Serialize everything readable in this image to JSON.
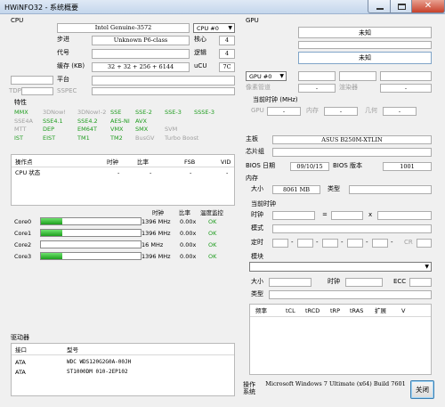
{
  "window": {
    "title": "HWiNFO32 - 系统概要"
  },
  "cpu": {
    "section": "CPU",
    "model": "Intel Genuine-3572",
    "selector": "CPU #0",
    "stepping_label": "步进",
    "stepping": "Unknown P6-class",
    "cores_label": "核心",
    "cores": "4",
    "codename_label": "代号",
    "logical_label": "逻辑",
    "logical": "4",
    "cache_label": "缓存 (KB)",
    "cache": "32 + 32 + 256 + 6144",
    "ucu_label": "uCU",
    "ucu": "7C",
    "platform_label": "平台",
    "tdp_label": "TDP",
    "sspec_label": "SSPEC",
    "features_label": "特性",
    "features": [
      [
        {
          "t": "MMX",
          "c": "g"
        },
        {
          "t": "3DNow!",
          "c": "x"
        },
        {
          "t": "3DNow!-2",
          "c": "x"
        },
        {
          "t": "SSE",
          "c": "g"
        },
        {
          "t": "SSE-2",
          "c": "g"
        },
        {
          "t": "SSE-3",
          "c": "g"
        },
        {
          "t": "SSSE-3",
          "c": "g"
        }
      ],
      [
        {
          "t": "SSE4A",
          "c": "x"
        },
        {
          "t": "SSE4.1",
          "c": "g"
        },
        {
          "t": "SSE4.2",
          "c": "g"
        },
        {
          "t": "AES-NI",
          "c": "g"
        },
        {
          "t": "AVX",
          "c": "g"
        }
      ],
      [
        {
          "t": "MTT",
          "c": "x"
        },
        {
          "t": "DEP",
          "c": "g"
        },
        {
          "t": "EM64T",
          "c": "g"
        },
        {
          "t": "VMX",
          "c": "g"
        },
        {
          "t": "SMX",
          "c": "g"
        },
        {
          "t": "SVM",
          "c": "x"
        }
      ],
      [
        {
          "t": "IST",
          "c": "g"
        },
        {
          "t": "EIST",
          "c": "g"
        },
        {
          "t": "TM1",
          "c": "g"
        },
        {
          "t": "TM2",
          "c": "g"
        },
        {
          "t": "BusGV",
          "c": "x"
        },
        {
          "t": "Turbo Boost",
          "c": "x"
        }
      ]
    ],
    "op_headers": [
      "操作点",
      "时钟",
      "比率",
      "FSB",
      "VID"
    ],
    "op_rows": [
      [
        "CPU 状态",
        "-",
        "-",
        "-",
        "-"
      ]
    ],
    "core_headers": [
      "时钟",
      "比率",
      "温度监控"
    ],
    "cores_list": [
      {
        "name": "Core0",
        "pct": 0.8,
        "clock": "1396 MHz",
        "ratio": "0.00x",
        "status": "OK"
      },
      {
        "name": "Core1",
        "pct": 0.8,
        "clock": "1396 MHz",
        "ratio": "0.00x",
        "status": "OK"
      },
      {
        "name": "Core2",
        "pct": 0.0,
        "clock": "16 MHz",
        "ratio": "0.00x",
        "status": "OK"
      },
      {
        "name": "Core3",
        "pct": 0.8,
        "clock": "1396 MHz",
        "ratio": "0.00x",
        "status": "OK"
      }
    ]
  },
  "drives": {
    "section": "驱动器",
    "col_interface": "接口",
    "col_model": "型号",
    "rows": [
      {
        "iface": "ATA",
        "model": "WDC WDS120G2G0A-00JH"
      },
      {
        "iface": "ATA",
        "model": "ST1000DM 010-2EP102"
      }
    ]
  },
  "gpu": {
    "section": "GPU",
    "name1": "未知",
    "name2": "未知",
    "selector": "GPU #0",
    "dash": "-",
    "pixel_pipes_label": "像素管道",
    "shaders_label": "渲染器",
    "current_clock_label": "当前时钟 (MHz)",
    "gpu_label": "GPU",
    "mem_label": "内存",
    "geom_label": "几何"
  },
  "mb": {
    "mb_label": "主板",
    "mb_value": "ASUS B250M-XTLIN",
    "chipset_label": "芯片组",
    "bios_date_label": "BIOS 日期",
    "bios_date": "09/10/15",
    "bios_ver_label": "BIOS 版本",
    "bios_ver": "1001"
  },
  "memory": {
    "section": "内存",
    "size_label": "大小",
    "size": "8061 MB",
    "type_label": "类型",
    "timing_label": "当前时钟",
    "clock_label": "时钟",
    "eq": "=",
    "x": "x",
    "mode_label": "模式",
    "timing_row_label": "定时",
    "cr_label": "CR",
    "module_label": "模块",
    "mod_size_label": "大小",
    "mod_clock_label": "时钟",
    "ecc_label": "ECC",
    "mod_type_label": "类型",
    "mod_headers": [
      "频率",
      "tCL",
      "tRCD",
      "tRP",
      "tRAS",
      "扩展",
      "V"
    ]
  },
  "os": {
    "label": "操作\n系统",
    "value": "Microsoft Windows 7 Ultimate (x64) Build 7601",
    "close": "关闭"
  }
}
